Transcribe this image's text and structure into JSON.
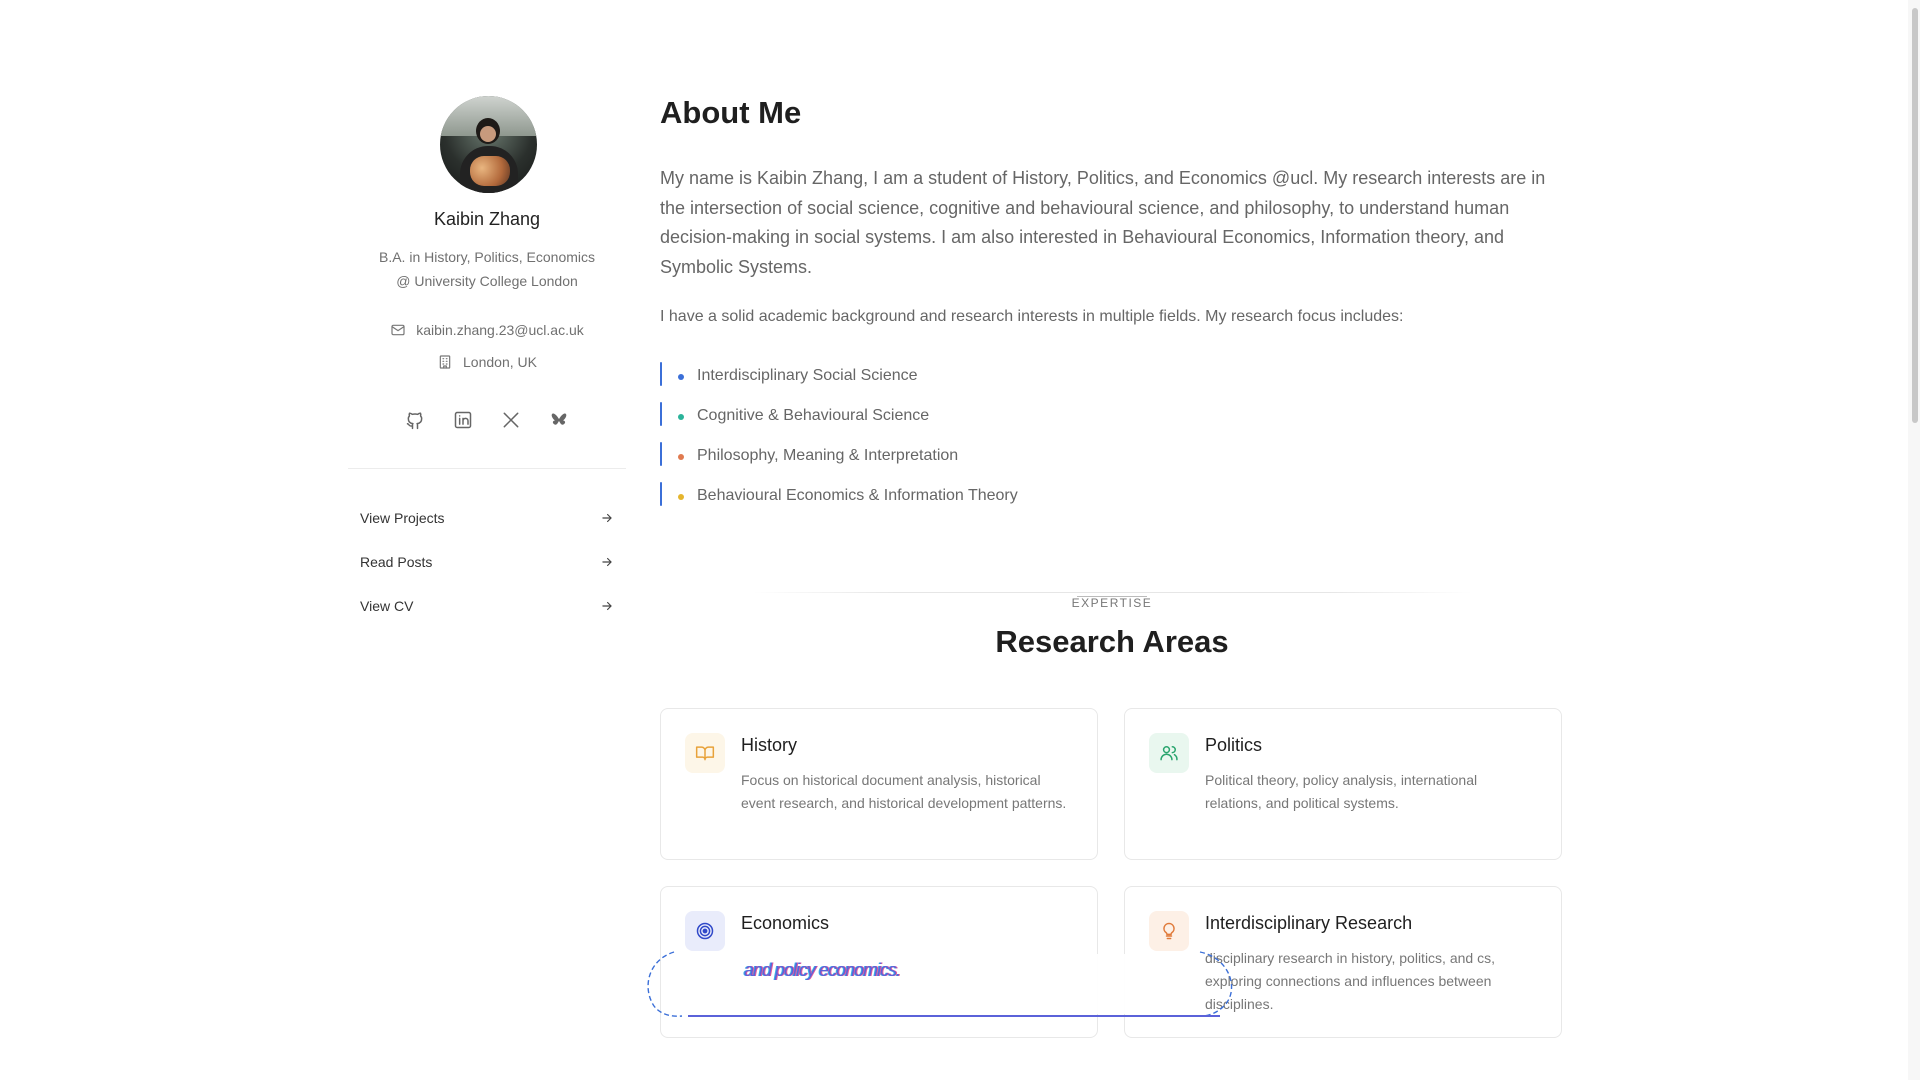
{
  "profile": {
    "name": "Kaibin Zhang",
    "degree_line1": "B.A. in History, Politics, Economics",
    "degree_line2": "@ University College London",
    "email": "kaibin.zhang.23@ucl.ac.uk",
    "location": "London, UK",
    "socials": [
      "github-icon",
      "linkedin-icon",
      "x-icon",
      "bluesky-icon"
    ]
  },
  "nav": [
    {
      "label": "View Projects"
    },
    {
      "label": "Read Posts"
    },
    {
      "label": "View CV"
    }
  ],
  "about": {
    "title": "About Me",
    "intro": "My name is Kaibin Zhang, I am a student of History, Politics, and Economics @ucl. My research interests are in the intersection of social science, cognitive and behavioural science, and philosophy, to understand human decision-making in social systems. I am also interested in Behavioural Economics, Information theory, and Symbolic Systems.",
    "focus_intro": "I have a solid academic background and research interests in multiple fields. My research focus includes:",
    "interests": [
      {
        "label": "Interdisciplinary Social Science",
        "color": "#3b6fd8"
      },
      {
        "label": "Cognitive & Behavioural Science",
        "color": "#2bb39a"
      },
      {
        "label": "Philosophy, Meaning & Interpretation",
        "color": "#e07a4f"
      },
      {
        "label": "Behavioural Economics & Information Theory",
        "color": "#e5b52d"
      }
    ]
  },
  "research": {
    "eyebrow": "EXPERTISE",
    "title": "Research Areas",
    "cards": [
      {
        "title": "History",
        "icon": "book-icon",
        "accent": "#e8a23a",
        "bg": "#fdf6e8",
        "desc": "Focus on historical document analysis, historical event research, and historical development patterns."
      },
      {
        "title": "Politics",
        "icon": "users-icon",
        "accent": "#2aa56e",
        "bg": "#e9f7ef",
        "desc": "Political theory, policy analysis, international relations, and political systems."
      },
      {
        "title": "Economics",
        "icon": "target-icon",
        "accent": "#3049c9",
        "bg": "#e9ecfb",
        "desc": "and policy economics."
      },
      {
        "title": "Interdisciplinary Research",
        "icon": "lightbulb-icon",
        "accent": "#e07a3a",
        "bg": "#fdf0e6",
        "desc": "disciplinary research in history, politics, and cs, exploring connections and influences between disciplines."
      }
    ]
  },
  "colors": {
    "accent": "#5b62d9"
  }
}
